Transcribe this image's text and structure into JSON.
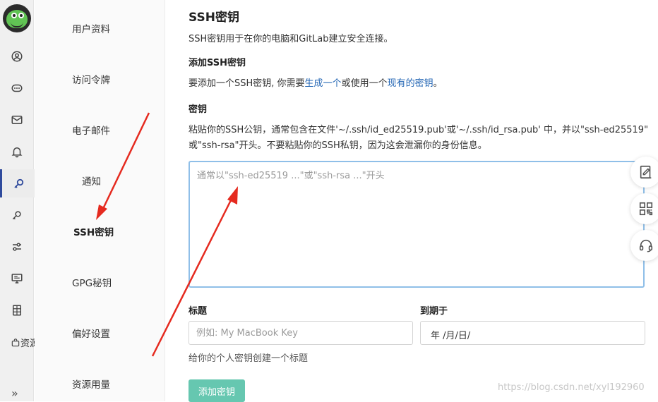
{
  "rail": {
    "items": [
      {
        "icon": "user-circle-icon"
      },
      {
        "icon": "chat-icon"
      },
      {
        "icon": "mail-icon"
      },
      {
        "icon": "bell-icon"
      },
      {
        "icon": "key-icon",
        "active": true
      },
      {
        "icon": "key-small-icon"
      },
      {
        "icon": "sliders-icon"
      },
      {
        "icon": "monitor-icon"
      },
      {
        "icon": "table-icon"
      }
    ],
    "resource_label": "资源",
    "collapse_label": "»"
  },
  "subnav": {
    "items": [
      {
        "label": "用户资料"
      },
      {
        "label": "访问令牌"
      },
      {
        "label": "电子邮件"
      },
      {
        "label": "通知"
      },
      {
        "label": "SSH密钥",
        "active": true
      },
      {
        "label": "GPG秘钥"
      },
      {
        "label": "偏好设置"
      },
      {
        "label": "资源用量"
      }
    ]
  },
  "main": {
    "title": "SSH密钥",
    "description": "SSH密钥用于在你的电脑和GitLab建立安全连接。",
    "add_section": {
      "title": "添加SSH密钥",
      "text_before": "要添加一个SSH密钥, 你需要",
      "link_generate": "生成一个",
      "text_middle": "或使用一个",
      "link_existing": "现有的密钥",
      "text_after": "。"
    },
    "key": {
      "label": "密钥",
      "help_line1": "粘贴你的SSH公钥，通常包含在文件'~/.ssh/id_ed25519.pub'或'~/.ssh/id_rsa.pub' 中，并以\"ssh-ed25519\"",
      "help_line2": "或\"ssh-rsa\"开头。不要粘贴你的SSH私钥，因为这会泄漏你的身份信息。",
      "placeholder": "通常以\"ssh-ed25519 ...\"或\"ssh-rsa ...\"开头",
      "value": ""
    },
    "title_field": {
      "label": "标题",
      "placeholder": "例如: My MacBook Key",
      "value": "",
      "help": "给你的个人密钥创建一个标题"
    },
    "expiry_field": {
      "label": "到期于",
      "value": "年 /月/日/"
    },
    "submit_label": "添加密钥"
  },
  "floating": [
    "edit-icon",
    "qr-code-icon",
    "headset-icon"
  ],
  "watermark": "https://blog.csdn.net/xyl192960",
  "colors": {
    "link": "#1f63b3",
    "accent": "#66c7b0",
    "textarea_border": "#8fbfe8",
    "annotation": "#e52a1f"
  }
}
